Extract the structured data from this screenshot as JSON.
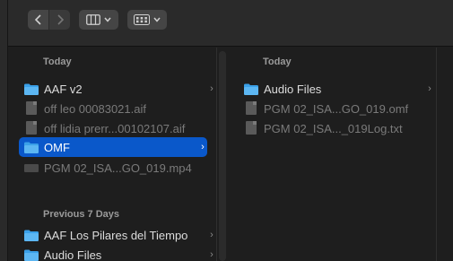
{
  "toolbar": {
    "back_icon": "chevron-left-icon",
    "forward_icon": "chevron-right-icon",
    "columns_view_icon": "columns-view-icon",
    "group_icon": "grid-group-icon"
  },
  "column1": {
    "section_today": "Today",
    "today_items": [
      {
        "label": "AAF v2",
        "type": "folder",
        "has_children": true
      },
      {
        "label": "off leo 00083021.aif",
        "type": "file",
        "dim": true
      },
      {
        "label": "off lidia prerr...00102107.aif",
        "type": "file",
        "dim": true
      },
      {
        "label": "OMF",
        "type": "folder",
        "has_children": true,
        "selected": true
      },
      {
        "label": "PGM 02_ISA...GO_019.mp4",
        "type": "video",
        "dim": true
      }
    ],
    "section_previous": "Previous 7 Days",
    "previous_items": [
      {
        "label": "AAF Los Pilares del Tiempo",
        "type": "folder",
        "has_children": true
      },
      {
        "label": "Audio Files",
        "type": "folder",
        "has_children": true
      }
    ]
  },
  "column2": {
    "section_today": "Today",
    "items": [
      {
        "label": "Audio Files",
        "type": "folder",
        "has_children": true
      },
      {
        "label": "PGM 02_ISA...GO_019.omf",
        "type": "file",
        "dim": true
      },
      {
        "label": "PGM 02_ISA..._019Log.txt",
        "type": "file",
        "dim": true
      }
    ]
  },
  "colors": {
    "selection": "#0a58ca",
    "folder": "#3aa0e8",
    "background": "#1e1e1e"
  }
}
